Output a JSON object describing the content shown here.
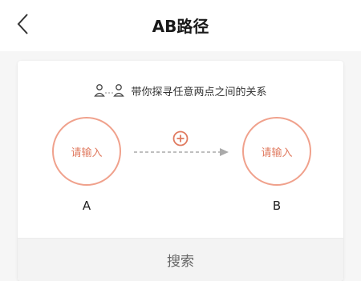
{
  "header": {
    "title": "AB路径",
    "back_icon": "chevron-left-icon"
  },
  "card": {
    "subtitle": "带你探寻任意两点之间的关系",
    "subtitle_icon": "two-persons-link-icon",
    "node_a": {
      "placeholder": "请输入",
      "label": "A"
    },
    "node_b": {
      "placeholder": "请输入",
      "label": "B"
    },
    "add_icon": "plus-circle-icon",
    "search_label": "搜索"
  },
  "colors": {
    "accent": "#e07a5f",
    "circle_border": "#f0a18c",
    "arrow": "#aaaaaa"
  }
}
